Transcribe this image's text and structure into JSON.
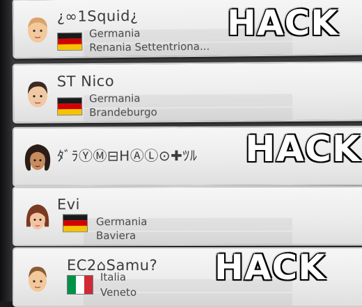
{
  "players": [
    {
      "name": "¿∞1Squid¿",
      "country": "Germania",
      "region": "Renania Settentriona...",
      "flag": "de"
    },
    {
      "name": "ST Nico",
      "country": "Germania",
      "region": "Brandeburgo",
      "flag": "de"
    },
    {
      "name": "ﾀﾞﾗⓎⓂ︎⊟HⒶⓁ⊙✚ﾂﾙ",
      "country": "",
      "region": "",
      "flag": ""
    },
    {
      "name": "Evi",
      "country": "Germania",
      "region": "Baviera",
      "flag": "de"
    },
    {
      "name": "EC2⌂Samu?",
      "country": "Italia",
      "region": "Veneto",
      "flag": "it"
    }
  ],
  "overlay": {
    "label": "HACK"
  },
  "colors": {
    "de": [
      "#1a1a1a",
      "#d40000",
      "#f5c400"
    ],
    "it": [
      "#009246",
      "#ffffff",
      "#ce2b37"
    ]
  }
}
